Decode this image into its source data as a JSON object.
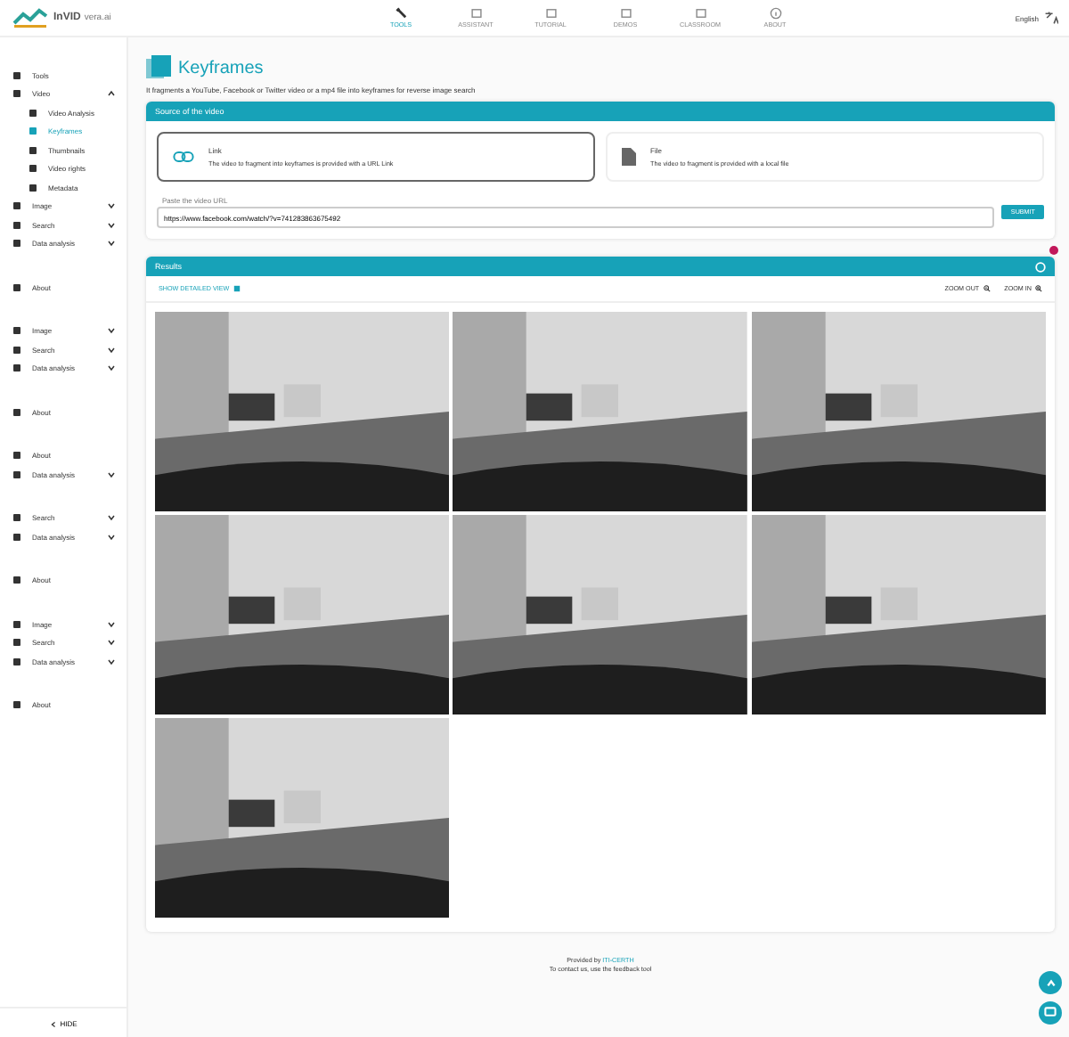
{
  "header": {
    "logo_text": "InVID",
    "logo_sub": "vera.ai",
    "nav": [
      {
        "label": "TOOLS",
        "selected": true
      },
      {
        "label": "ASSISTANT",
        "selected": false
      },
      {
        "label": "TUTORIAL",
        "selected": false
      },
      {
        "label": "DEMOS",
        "selected": false
      },
      {
        "label": "CLASSROOM",
        "selected": false
      },
      {
        "label": "ABOUT",
        "selected": false
      }
    ],
    "language": "English"
  },
  "sidebar": {
    "groups": [
      [
        {
          "label": "Tools",
          "kind": "item",
          "selected": false
        },
        {
          "label": "Video",
          "kind": "item",
          "selected": false,
          "expanded": true
        },
        {
          "label": "Video Analysis",
          "kind": "sub",
          "selected": false
        },
        {
          "label": "Keyframes",
          "kind": "sub",
          "selected": true
        },
        {
          "label": "Thumbnails",
          "kind": "sub",
          "selected": false
        },
        {
          "label": "Video rights",
          "kind": "sub",
          "selected": false
        },
        {
          "label": "Metadata",
          "kind": "sub",
          "selected": false
        },
        {
          "label": "Image",
          "kind": "item",
          "selected": false,
          "expanded": false
        },
        {
          "label": "Search",
          "kind": "item",
          "selected": false,
          "expanded": false
        },
        {
          "label": "Data analysis",
          "kind": "item",
          "selected": false,
          "expanded": false
        }
      ],
      [
        {
          "label": "About",
          "kind": "item",
          "selected": false
        }
      ],
      [
        {
          "label": "Image",
          "kind": "item",
          "selected": false,
          "expanded": false
        },
        {
          "label": "Search",
          "kind": "item",
          "selected": false,
          "expanded": false
        },
        {
          "label": "Data analysis",
          "kind": "item",
          "selected": false,
          "expanded": false
        }
      ],
      [
        {
          "label": "About",
          "kind": "item",
          "selected": false
        }
      ],
      [
        {
          "label": "About",
          "kind": "item",
          "selected": false
        },
        {
          "label": "Data analysis",
          "kind": "item",
          "selected": false,
          "expanded": false
        }
      ],
      [
        {
          "label": "Search",
          "kind": "item",
          "selected": false,
          "expanded": false
        },
        {
          "label": "Data analysis",
          "kind": "item",
          "selected": false,
          "expanded": false
        }
      ],
      [
        {
          "label": "About",
          "kind": "item",
          "selected": false
        }
      ],
      [
        {
          "label": "Image",
          "kind": "item",
          "selected": false,
          "expanded": false
        },
        {
          "label": "Search",
          "kind": "item",
          "selected": false,
          "expanded": false
        },
        {
          "label": "Data analysis",
          "kind": "item",
          "selected": false,
          "expanded": false
        }
      ],
      [
        {
          "label": "About",
          "kind": "item",
          "selected": false
        }
      ]
    ],
    "hide_label": "HIDE"
  },
  "page": {
    "title": "Keyframes",
    "description": "It fragments a YouTube, Facebook or Twitter video or a mp4 file into keyframes for reverse image search"
  },
  "source_panel": {
    "title": "Source of the video",
    "options": [
      {
        "title": "Link",
        "description": "The video to fragment into keyframes is provided with a URL Link",
        "selected": true
      },
      {
        "title": "File",
        "description": "The video to fragment is provided with a local file",
        "selected": false
      }
    ],
    "url_field": {
      "label": "Paste the video URL",
      "value": "https://www.facebook.com/watch/?v=741283863675492"
    },
    "submit": "SUBMIT"
  },
  "results_panel": {
    "title": "Results",
    "detailed_view": "SHOW DETAILED VIEW",
    "zoom_out": "ZOOM OUT",
    "zoom_in": "ZOOM IN"
  },
  "footer": {
    "provided_by": "Provided by",
    "provider": "ITI-CERTH",
    "contact": "To contact us, use the feedback tool"
  }
}
